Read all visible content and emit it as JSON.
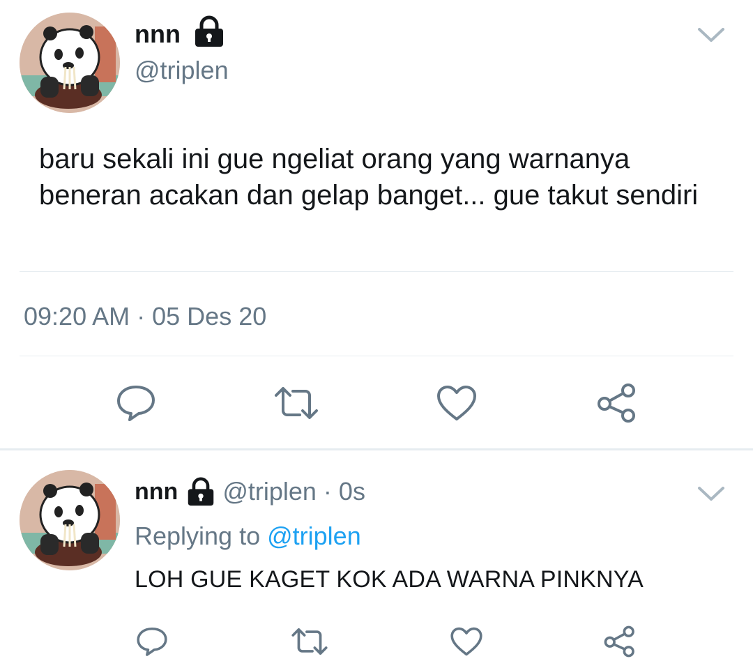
{
  "main_tweet": {
    "display_name": "nnn",
    "handle": "@triplen",
    "text": "baru sekali ini gue ngeliat orang yang warnanya beneran acakan dan gelap banget... gue takut sendiri",
    "time": "09:20 AM",
    "separator": "·",
    "date": "05 Des 20"
  },
  "reply_tweet": {
    "display_name": "nnn",
    "handle": "@triplen",
    "separator": "·",
    "age": "0s",
    "replying_label": "Replying to",
    "replying_handle": "@triplen",
    "text": "LOH GUE KAGET KOK ADA WARNA PINKNYA"
  },
  "icons": {
    "lock": "lock-icon",
    "chevron": "chevron-down-icon",
    "reply": "reply-icon",
    "retweet": "retweet-icon",
    "like": "heart-icon",
    "share": "share-icon"
  },
  "colors": {
    "text": "#14171a",
    "secondary": "#657786",
    "link": "#1da1f2",
    "divider": "#e6ecf0"
  }
}
